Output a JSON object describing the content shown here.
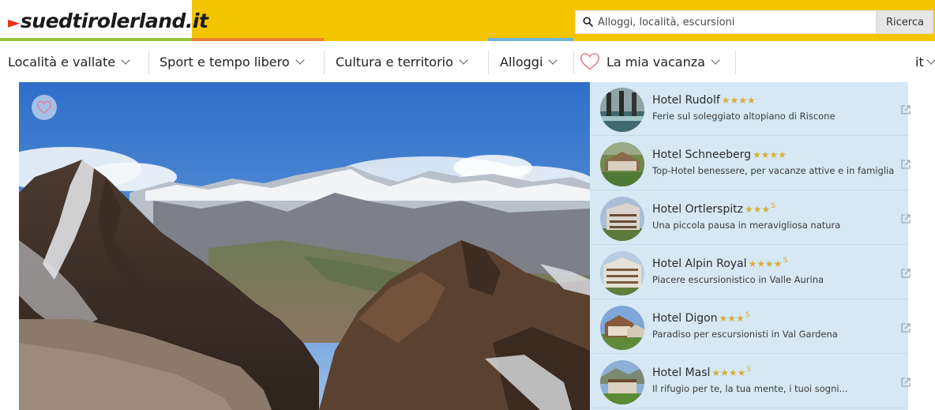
{
  "header": {
    "logo_text": "suedtirolerland.it",
    "search_placeholder": "Alloggi, località, escursioni",
    "search_button": "Ricerca"
  },
  "nav": {
    "items": [
      {
        "label": "Località e vallate"
      },
      {
        "label": "Sport e tempo libero"
      },
      {
        "label": "Cultura e territorio"
      },
      {
        "label": "Alloggi"
      },
      {
        "label": "La mia vacanza"
      }
    ],
    "language": "it"
  },
  "hero": {
    "favorite_icon": "heart-outline-icon"
  },
  "hotels": [
    {
      "name": "Hotel Rudolf",
      "stars": "★★★★",
      "superior": "",
      "description": "Ferie sul soleggiato altopiano di Riscone"
    },
    {
      "name": "Hotel Schneeberg",
      "stars": "★★★★",
      "superior": "",
      "description": "Top-Hotel benessere, per vacanze attive e in famiglia"
    },
    {
      "name": "Hotel Ortlerspitz",
      "stars": "★★★",
      "superior": "S",
      "description": "Una piccola pausa in meravigliosa natura"
    },
    {
      "name": "Hotel Alpin Royal",
      "stars": "★★★★",
      "superior": "S",
      "description": "Piacere escursionistico in Valle Aurina"
    },
    {
      "name": "Hotel Digon",
      "stars": "★★★",
      "superior": "S",
      "description": "Paradiso per escursionisti in Val Gardena"
    },
    {
      "name": "Hotel Masl",
      "stars": "★★★★",
      "superior": "S",
      "description": "Il rifugio per te, la tua mente, i tuoi sogni..."
    }
  ],
  "colors": {
    "brand_yellow": "#f2c500",
    "logo_arrow": "#e6331a",
    "star_gold": "#d8ac38",
    "hotel_panel": "#d5e8f4",
    "heart_pink": "#e58090"
  }
}
